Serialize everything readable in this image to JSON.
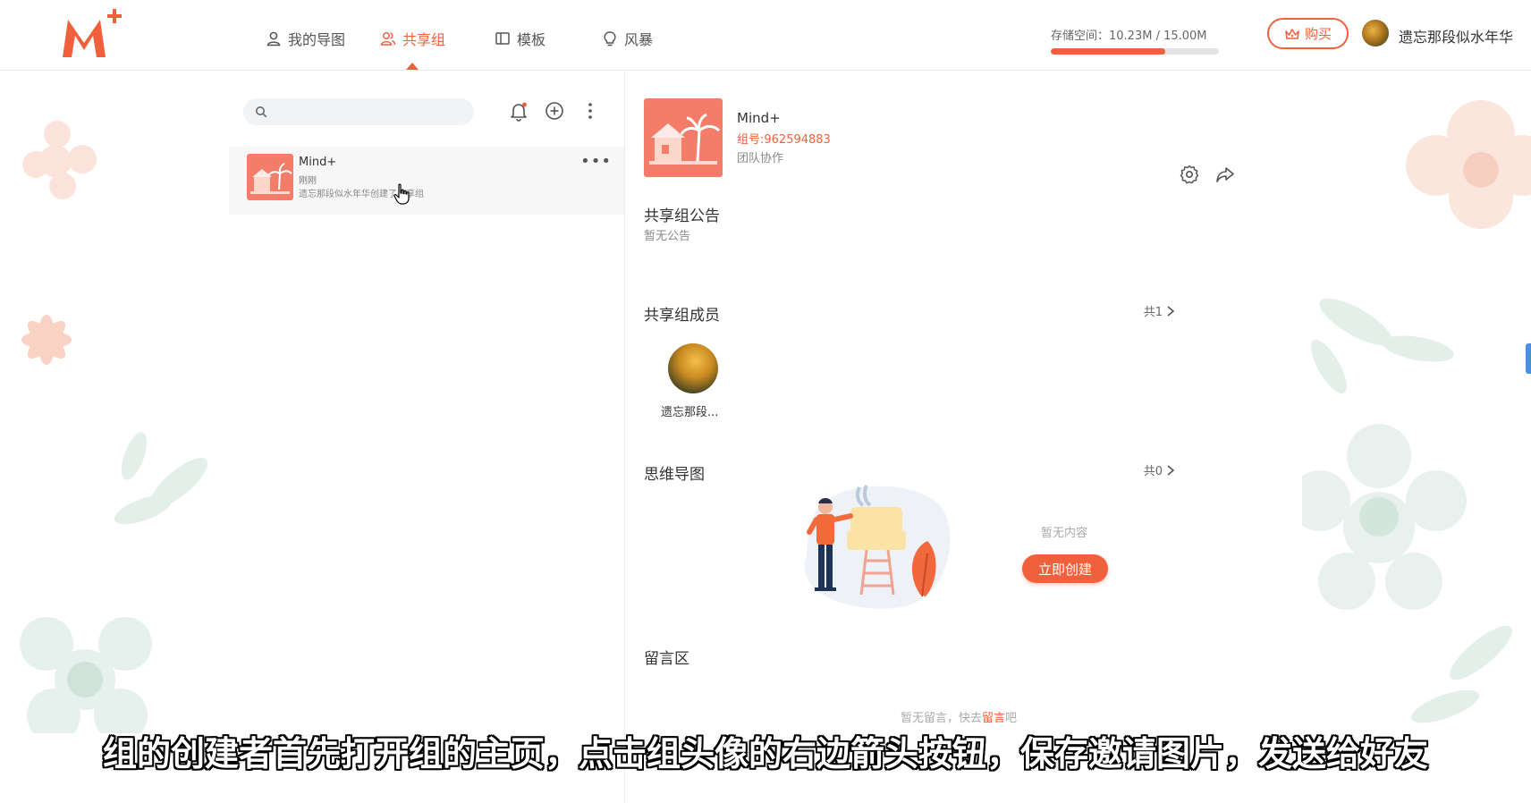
{
  "header": {
    "nav": [
      {
        "label": "我的导图",
        "icon": "user-icon",
        "active": false
      },
      {
        "label": "共享组",
        "icon": "group-icon",
        "active": true
      },
      {
        "label": "模板",
        "icon": "template-icon",
        "active": false
      },
      {
        "label": "风暴",
        "icon": "lightbulb-icon",
        "active": false
      }
    ],
    "storage_label": "存储空间：10.23M / 15.00M",
    "storage_used_fraction": 0.682,
    "buy_label": "购买",
    "username": "遗忘那段似水年华"
  },
  "sidebar": {
    "search_placeholder": "",
    "groups": [
      {
        "name": "Mind+",
        "time": "刚刚",
        "desc": "遗忘那段似水年华创建了共享组",
        "more": "•••"
      }
    ]
  },
  "detail": {
    "name": "Mind+",
    "group_id": "组号:962594883",
    "type": "团队协作",
    "announcement": {
      "title": "共享组公告",
      "body": "暂无公告"
    },
    "members": {
      "title": "共享组成员",
      "count": "共1",
      "items": [
        {
          "name": "遗忘那段..."
        }
      ]
    },
    "mindmaps": {
      "title": "思维导图",
      "count": "共0",
      "empty_text": "暂无内容",
      "create_label": "立即创建"
    },
    "comments": {
      "title": "留言区",
      "hint_prefix": "暂无留言，快去",
      "hint_link": "留言",
      "hint_suffix": "吧"
    }
  },
  "subtitle": "组的创建者首先打开组的主页，点击组头像的右边箭头按钮，保存邀请图片，发送给好友",
  "colors": {
    "accent": "#f0603c",
    "thumb": "#f47c68"
  }
}
